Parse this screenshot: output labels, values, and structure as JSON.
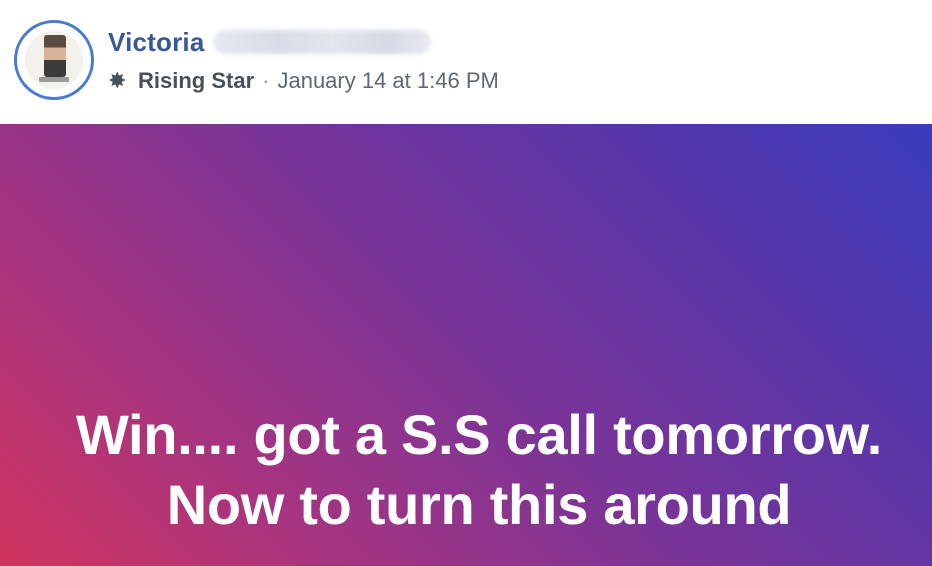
{
  "post": {
    "author": {
      "name": "Victoria"
    },
    "badge": {
      "icon": "star-icon",
      "label": "Rising Star"
    },
    "separator": "·",
    "timestamp": "January 14 at 1:46 PM",
    "banner": {
      "line1": "Win.... got a S.S call tomorrow.",
      "line2": "Now to turn this around",
      "gradient_colors": [
        "#d0345e",
        "#7a3497",
        "#3a3cbc"
      ]
    }
  },
  "colors": {
    "author_name": "#385898",
    "avatar_border": "#4a7bd0"
  }
}
